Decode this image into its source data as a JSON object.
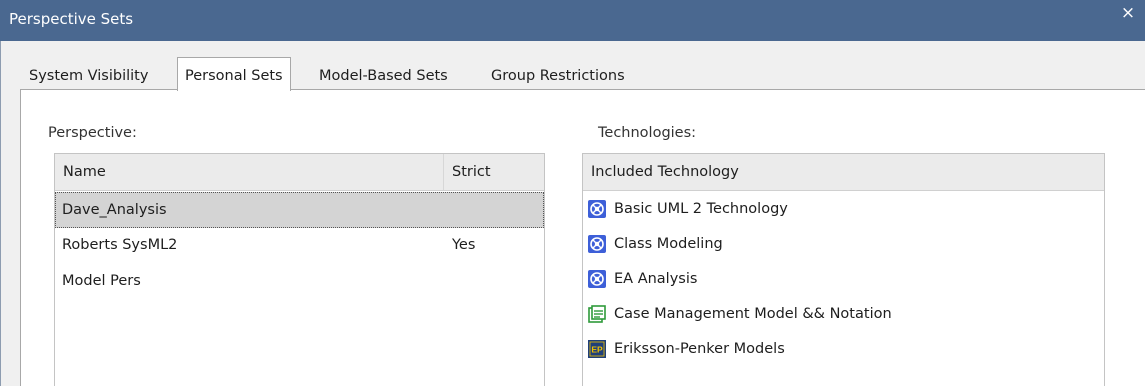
{
  "window": {
    "title": "Perspective Sets",
    "close_glyph": "×"
  },
  "tabs": [
    {
      "label": "System Visibility",
      "active": false
    },
    {
      "label": "Personal Sets",
      "active": true
    },
    {
      "label": "Model-Based Sets",
      "active": false
    },
    {
      "label": "Group Restrictions",
      "active": false
    }
  ],
  "perspective": {
    "section_label": "Perspective:",
    "columns": {
      "name": "Name",
      "strict": "Strict"
    },
    "rows": [
      {
        "name": "Dave_Analysis",
        "strict": "",
        "selected": true
      },
      {
        "name": "Roberts SysML2",
        "strict": "Yes",
        "selected": false
      },
      {
        "name": "Model Pers",
        "strict": "",
        "selected": false
      }
    ]
  },
  "technologies": {
    "section_label": "Technologies:",
    "column": "Included Technology",
    "rows": [
      {
        "label": "Basic UML 2 Technology",
        "icon": "uml-technology-icon"
      },
      {
        "label": "Class Modeling",
        "icon": "uml-technology-icon"
      },
      {
        "label": "EA Analysis",
        "icon": "uml-technology-icon"
      },
      {
        "label": "Case Management Model && Notation",
        "icon": "case-management-icon"
      },
      {
        "label": "Eriksson-Penker Models",
        "icon": "eriksson-penker-icon",
        "icon_text": "EP"
      }
    ]
  },
  "colors": {
    "titlebar": "#4a6890",
    "selection": "#d4d4d4",
    "uml_icon": "#3d5fd8",
    "case_icon": "#2e9a3a",
    "ep_icon": "#1f3f7a",
    "ep_text": "#f2c200"
  }
}
